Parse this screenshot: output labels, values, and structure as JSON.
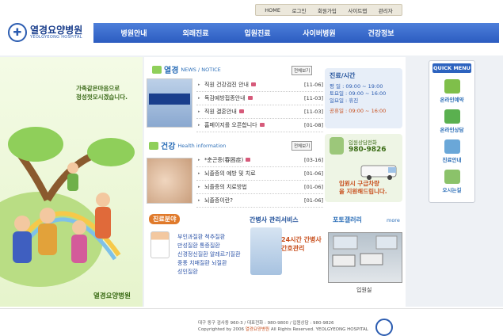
{
  "top_links": [
    "HOME",
    "로그인",
    "회원가입",
    "사이트맵",
    "관리자"
  ],
  "logo": {
    "title": "열경요양병원",
    "subtitle": "YEOLGYEONG HOSPITAL"
  },
  "nav": [
    "병원안내",
    "외래진료",
    "입원진료",
    "사이버병원",
    "건강정보"
  ],
  "hero": {
    "slogan_1": "가족같은마음으로",
    "slogan_2": "정성껏모시겠습니다.",
    "brand": "열경요양병원"
  },
  "news": {
    "title_big": "열경",
    "title_small": "NEWS / NOTICE",
    "more": "전체보기",
    "items": [
      {
        "text": "직원 건강검진 안내",
        "date": "[11-06]"
      },
      {
        "text": "독감예방접종안내",
        "date": "[11-03]"
      },
      {
        "text": "직원 결혼안내",
        "date": "[11-03]"
      },
      {
        "text": "홈페이지를 오픈합니다",
        "date": "[01-08]"
      }
    ]
  },
  "health": {
    "title_big": "건강",
    "title_small": "Health information",
    "more": "전체보기",
    "items": [
      {
        "text": "*춘곤증(春困症)",
        "date": "[03-16]"
      },
      {
        "text": "뇌졸증의 예방 및 치료",
        "date": "[01-06]"
      },
      {
        "text": "뇌졸증의 치료방법",
        "date": "[01-06]"
      },
      {
        "text": "뇌졸증이란?",
        "date": "[01-06]"
      }
    ]
  },
  "hours": {
    "title": "진료/시간",
    "lines": [
      "평   일 : 09:00 ~ 19:00",
      "토요일 : 09:00 ~ 16:00",
      "일요일 : 휴진"
    ],
    "holiday": "공휴일 : 09:00 ~ 16:00"
  },
  "counsel": {
    "label": "입원상담전화",
    "phone": "980-9826",
    "pickup_1": "입원시 구급차량",
    "pickup_2": "을 지원해드립니다."
  },
  "quick_menu": {
    "title": "QUICK MENU",
    "items": [
      "온라인예약",
      "온라인상담",
      "진료안내",
      "오시는길"
    ]
  },
  "clinic": {
    "title": "진료분야",
    "items": [
      "부인과질환 척추질환",
      "만성질환 통증질환",
      "신경정신질환 알레르기질환",
      "중풍 치매질환 뇌질환",
      "성인질환"
    ]
  },
  "nurse": {
    "title": "간병사 관리서비스",
    "line_1": "24시간 간병사",
    "line_2": "간호관리"
  },
  "photo": {
    "title": "포토갤러리",
    "more": "more",
    "caption": "입원실"
  },
  "footer": {
    "line_1": "대구 동구 검사동 960-3  /  대표전화 : 980-9800  /  입원상담 : 980-9826",
    "line_2_pre": "Copyrighted by 2006",
    "line_2_brand": "열경요양병원",
    "line_2_post": "All Rights Reserved. YEOLGYEONG HOSPITAL"
  }
}
